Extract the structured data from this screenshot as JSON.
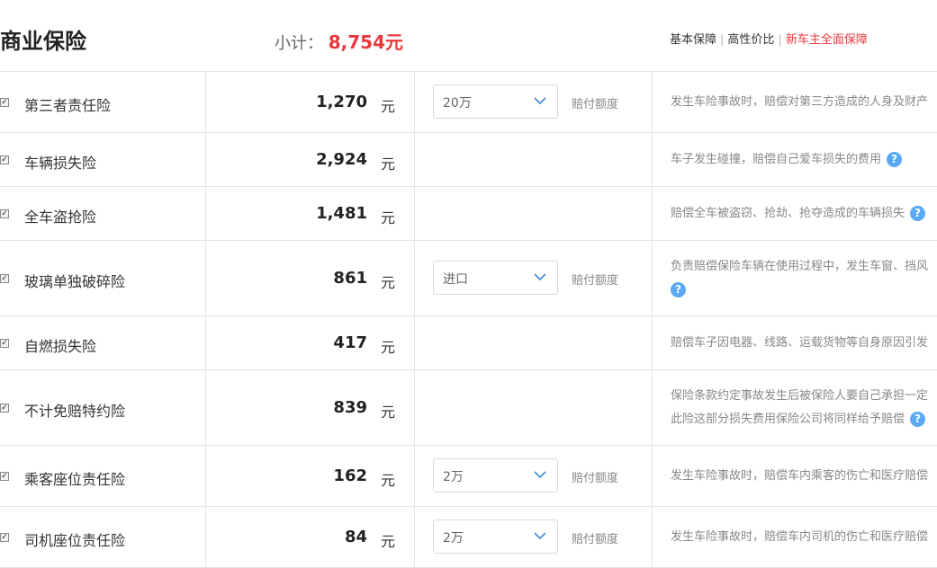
{
  "header": {
    "title": "商业保险",
    "subtotal_label": "小计：",
    "subtotal_value": "8,754元",
    "presets": [
      "基本保障",
      "高性价比",
      "新车主全面保障"
    ]
  },
  "unit": "元",
  "quota_label": "赔付额度",
  "help_glyph": "?",
  "rows": [
    {
      "name": "第三者责任险",
      "price": "1,270",
      "select": "20万",
      "desc": "发生车险事故时，赔偿对第三方造成的人身及财产"
    },
    {
      "name": "车辆损失险",
      "price": "2,924",
      "desc": "车子发生碰撞，赔偿自己爱车损失的费用"
    },
    {
      "name": "全车盗抢险",
      "price": "1,481",
      "desc": "赔偿全车被盗窃、抢劫、抢夺造成的车辆损失"
    },
    {
      "name": "玻璃单独破碎险",
      "price": "861",
      "select": "进口",
      "desc": "负责赔偿保险车辆在使用过程中，发生车窗、挡风"
    },
    {
      "name": "自燃损失险",
      "price": "417",
      "desc": "赔偿车子因电器、线路、运载货物等自身原因引发"
    },
    {
      "name": "不计免赔特约险",
      "price": "839",
      "desc_lines": [
        "保险条款约定事故发生后被保险人要自己承担一定",
        "此险这部分损失费用保险公司将同样给予赔偿"
      ]
    },
    {
      "name": "乘客座位责任险",
      "price": "162",
      "select": "2万",
      "desc": "发生车险事故时，赔偿车内乘客的伤亡和医疗赔偿"
    },
    {
      "name": "司机座位责任险",
      "price": "84",
      "select": "2万",
      "desc": "发生车险事故时，赔偿车内司机的伤亡和医疗赔偿"
    }
  ]
}
